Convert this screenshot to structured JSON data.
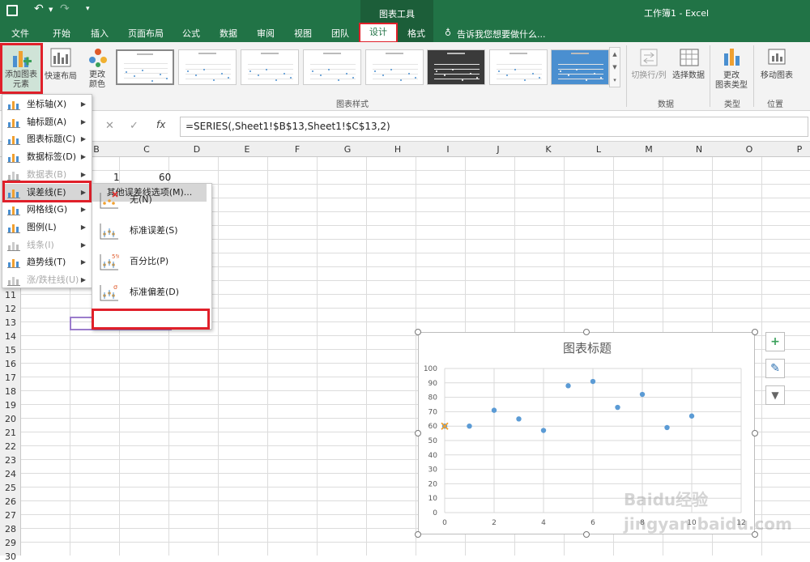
{
  "titlebar": {
    "title": "工作簿1 - Excel",
    "context_tab": "图表工具"
  },
  "tabs": [
    "文件",
    "开始",
    "插入",
    "页面布局",
    "公式",
    "数据",
    "审阅",
    "视图",
    "团队",
    "设计",
    "格式"
  ],
  "tell_me": "告诉我您想要做什么...",
  "ribbon": {
    "add_chart_element": "添加图表\n元素",
    "quick_layout": "快速布局",
    "change_colors": "更改\n颜色",
    "chart_styles_label": "图表样式",
    "switch_row_col": "切换行/列",
    "select_data": "选择数据",
    "data_label": "数据",
    "change_chart_type": "更改\n图表类型",
    "type_label": "类型",
    "move_chart": "移动图表",
    "location_label": "位置"
  },
  "formula": "=SERIES(,Sheet1!$B$13,Sheet1!$C$13,2)",
  "columns": [
    "B",
    "C",
    "D",
    "E",
    "F",
    "G",
    "H",
    "I",
    "J",
    "K",
    "L",
    "M",
    "N",
    "O",
    "P"
  ],
  "rows": [
    "11",
    "12",
    "13",
    "14",
    "15",
    "16",
    "17",
    "18",
    "19",
    "20",
    "21",
    "22",
    "23",
    "24",
    "25",
    "26",
    "27",
    "28",
    "29",
    "30"
  ],
  "cells": {
    "b": "1",
    "c": "60"
  },
  "menu": [
    {
      "label": "坐标轴(X)",
      "disabled": false
    },
    {
      "label": "轴标题(A)",
      "disabled": false
    },
    {
      "label": "图表标题(C)",
      "disabled": false
    },
    {
      "label": "数据标签(D)",
      "disabled": false
    },
    {
      "label": "数据表(B)",
      "disabled": true
    },
    {
      "label": "误差线(E)",
      "disabled": false
    },
    {
      "label": "网格线(G)",
      "disabled": false
    },
    {
      "label": "图例(L)",
      "disabled": false
    },
    {
      "label": "线条(I)",
      "disabled": true
    },
    {
      "label": "趋势线(T)",
      "disabled": false
    },
    {
      "label": "涨/跌柱线(U)",
      "disabled": true
    }
  ],
  "submenu": [
    "无(N)",
    "标准误差(S)",
    "百分比(P)",
    "标准偏差(D)"
  ],
  "submenu_more": "其他误差线选项(M)...",
  "chart_data": {
    "type": "scatter",
    "title": "图表标题",
    "x": [
      0,
      1,
      2,
      3,
      4,
      5,
      6,
      7,
      8,
      9,
      10
    ],
    "y": [
      60,
      60,
      71,
      65,
      57,
      88,
      91,
      73,
      82,
      59,
      67
    ],
    "xlim": [
      0,
      12
    ],
    "ylim": [
      0,
      100
    ],
    "xticks": [
      "0",
      "2",
      "4",
      "6",
      "8",
      "10",
      "12"
    ],
    "yticks": [
      "0",
      "10",
      "20",
      "30",
      "40",
      "50",
      "60",
      "70",
      "80",
      "90",
      "100"
    ],
    "grid": true,
    "color": "#5b9bd5"
  },
  "watermark": "Baidu经验 jingyan.baidu.com",
  "colors": {
    "excel_green": "#217346",
    "highlight_red": "#e0202a"
  }
}
